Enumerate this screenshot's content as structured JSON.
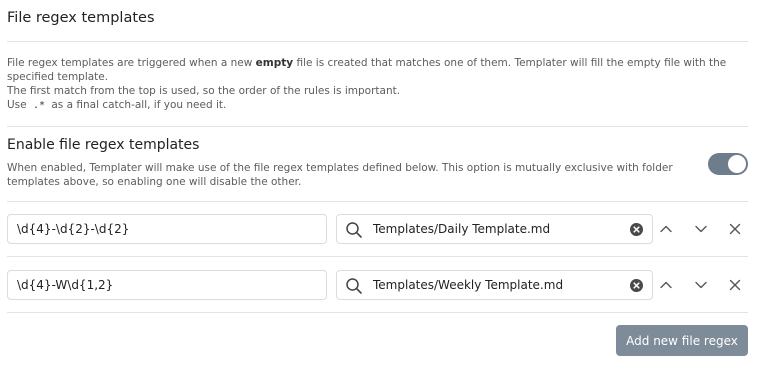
{
  "heading": "File regex templates",
  "description": {
    "line1_pre": "File regex templates are triggered when a new ",
    "line1_bold": "empty",
    "line1_post": " file is created that matches one of them. Templater will fill the empty file with the specified template.",
    "line2": "The first match from the top is used, so the order of the rules is important.",
    "line3_pre": "Use ",
    "line3_code": ".*",
    "line3_post": " as a final catch-all, if you need it."
  },
  "enable_setting": {
    "name": "Enable file regex templates",
    "description": "When enabled, Templater will make use of the file regex templates defined below. This option is mutually exclusive with folder templates above, so enabling one will disable the other.",
    "enabled": true
  },
  "rules": [
    {
      "regex": "\\d{4}-\\d{2}-\\d{2}",
      "template": "Templates/Daily Template.md"
    },
    {
      "regex": "\\d{4}-W\\d{1,2}",
      "template": "Templates/Weekly Template.md"
    }
  ],
  "add_button_label": "Add new file regex",
  "colors": {
    "toggle_on": "#6e7d8c",
    "button_bg": "#7e8c99",
    "text": "#222222",
    "muted_text": "#5c5c5c"
  }
}
